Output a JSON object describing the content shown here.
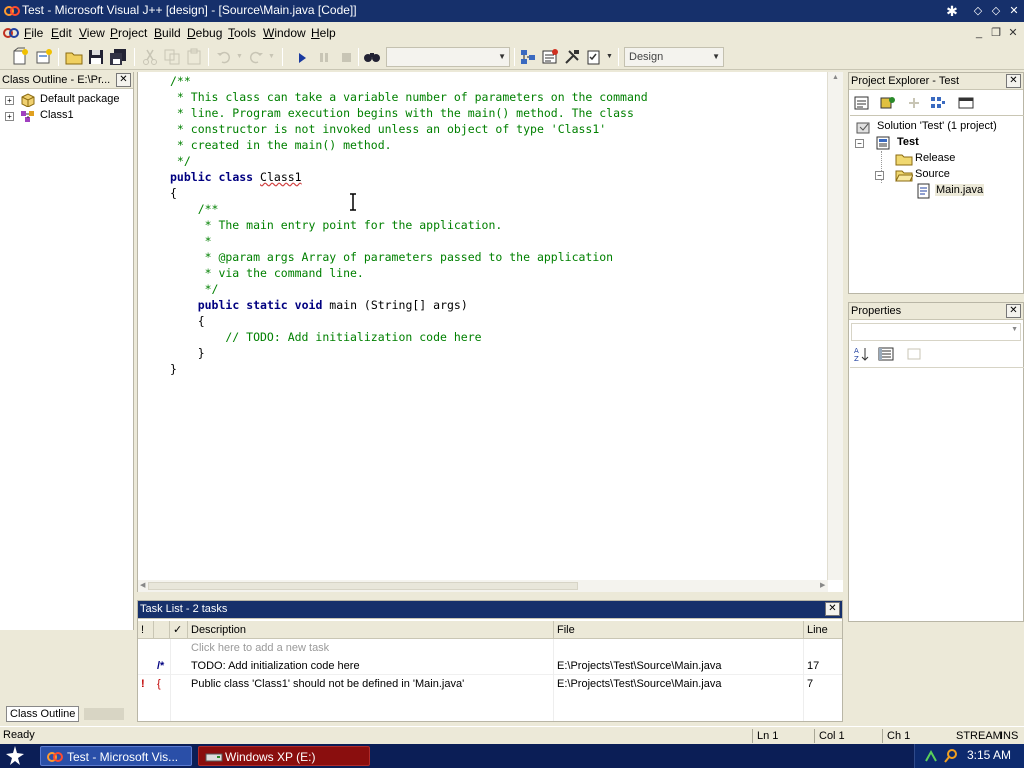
{
  "window": {
    "title": "Test - Microsoft Visual J++ [design] - [Source\\Main.java [Code]]"
  },
  "menu": [
    "File",
    "Edit",
    "View",
    "Project",
    "Build",
    "Debug",
    "Tools",
    "Window",
    "Help"
  ],
  "toolbar": {
    "find_combo_value": "",
    "config_combo_value": "Design"
  },
  "class_outline": {
    "title": "Class Outline - E:\\Pr...",
    "items": [
      "Default package",
      "Class1"
    ],
    "tab_label": "Class Outline"
  },
  "editor": {
    "code_lines": [
      "/**",
      " * This class can take a variable number of parameters on the command",
      " * line. Program execution begins with the main() method. The class",
      " * constructor is not invoked unless an object of type 'Class1'",
      " * created in the main() method.",
      " */",
      "public class Class1",
      "{",
      "    /**",
      "     * The main entry point for the application.",
      "     *",
      "     * @param args Array of parameters passed to the application",
      "     * via the command line.",
      "     */",
      "    public static void main (String[] args)",
      "    {",
      "        // TODO: Add initialization code here",
      "    }",
      "}"
    ]
  },
  "tasklist": {
    "title": "Task List - 2 tasks",
    "columns": {
      "priority": "!",
      "check": "✓",
      "description": "Description",
      "file": "File",
      "line": "Line"
    },
    "new_task_placeholder": "Click here to add a new task",
    "rows": [
      {
        "priority": "",
        "type": "/*",
        "description": "TODO: Add initialization code here",
        "file": "E:\\Projects\\Test\\Source\\Main.java",
        "line": "17"
      },
      {
        "priority": "!",
        "type": "{",
        "description": "Public class 'Class1' should not be defined in 'Main.java'",
        "file": "E:\\Projects\\Test\\Source\\Main.java",
        "line": "7"
      }
    ]
  },
  "project_explorer": {
    "title": "Project Explorer - Test",
    "solution": "Solution 'Test' (1 project)",
    "project": "Test",
    "folders": [
      "Release",
      "Source"
    ],
    "file": "Main.java"
  },
  "properties": {
    "title": "Properties"
  },
  "status": {
    "text": "Ready",
    "ln": "Ln 1",
    "col": "Col 1",
    "ch": "Ch 1",
    "mode1": "STREAM",
    "mode2": "INS"
  },
  "taskbar": {
    "items": [
      "Test - Microsoft Vis...",
      "Windows XP (E:)"
    ],
    "clock": "3:15 AM"
  },
  "colors": {
    "titlebar": "#16306b",
    "taskbar": "#0b1e56",
    "comment": "#008000",
    "keyword": "#000080"
  }
}
